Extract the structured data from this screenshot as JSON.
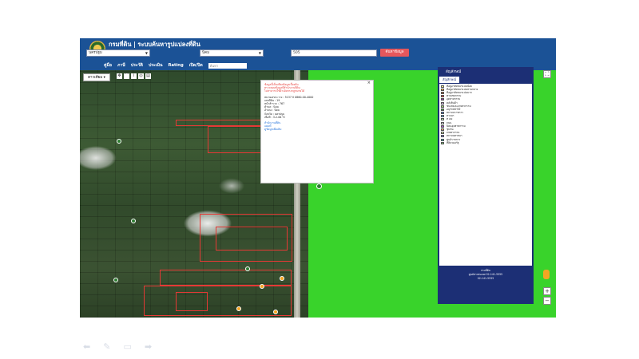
{
  "app": {
    "title": "กรมที่ดิน | ระบบค้นหารูปแปลงที่ดิน"
  },
  "search": {
    "province": "นครปฐม",
    "district": "นิคม",
    "parcel_no": "505",
    "button": "ค้นหาข้อมูล"
  },
  "menu": {
    "items": [
      "คู่มือ",
      "ภาษี",
      "ประวัติ",
      "ประเมิน",
      "Rating",
      "เปิด/ปิด"
    ],
    "search_placeholder": "ค้นหา"
  },
  "map": {
    "basemap_button": "ดาวเทียม",
    "popup": {
      "red_lines": [
        "ข้อมูลนี้เป็นเพียงข้อมูลเบื้องต้น",
        "ตรวจสอบข้อมูลที่สำนักงานที่ดิน",
        "ไม่สามารถใช้อ้างอิงทางกฎหมายได้"
      ],
      "fields": [
        "หมายเลขระวาง : 5137 II 0860-00-4000",
        "เลขที่ดิน : 19",
        "หน้าสำรวจ : 767",
        "ตำบล : นิคม",
        "อำเภอ : นิคม",
        "จังหวัด : นครปฐม",
        "เนื้อที่ : 3-2-64 ไร่"
      ],
      "links": [
        "สำนักงานที่ดิน",
        "แผนที่",
        "ดูข้อมูลเพิ่มเติม"
      ]
    }
  },
  "legend": {
    "title": "สัญลักษณ์",
    "tab": "สัญลักษณ์",
    "items": [
      {
        "label": "ที่อยู่อาศัยหนาแน่นน้อย",
        "color": "#f8f18a"
      },
      {
        "label": "ที่อยู่อาศัยหนาแน่นปานกลาง",
        "color": "#f3a83b"
      },
      {
        "label": "ที่อยู่อาศัยหนาแน่นมาก",
        "color": "#a35b2a"
      },
      {
        "label": "พาณิชยกรรม",
        "color": "#e53935"
      },
      {
        "label": "อุตสาหกรรม",
        "color": "#8e3fa5"
      },
      {
        "label": "คลังสินค้า",
        "color": "#c9a3d8"
      },
      {
        "label": "ชนบทและเกษตรกรรม",
        "color": "#9ad36b"
      },
      {
        "label": "อนุรักษ์ป่าไม้",
        "color": "#3f9a3a"
      },
      {
        "label": "สถาบันราชการ",
        "color": "#3d6fc9"
      },
      {
        "label": "ทางน้ำ",
        "color": "#56a8e0"
      },
      {
        "label": "ที่โล่ง",
        "color": "#b8e2a0"
      },
      {
        "label": "ถนน",
        "color": "#d3d3d3"
      },
      {
        "label": "นิคมอุตสาหกรรม",
        "color": "#a94ad2"
      },
      {
        "label": "ชุมชน",
        "color": "#e8a05c"
      },
      {
        "label": "เกษตรกรรม",
        "color": "#cfe89a"
      },
      {
        "label": "สถาบันศาสนา",
        "color": "#6b6bcc"
      },
      {
        "label": "ศูนย์ราชการ",
        "color": "#2aa7b0"
      },
      {
        "label": "ที่ดินของรัฐ",
        "color": "#7cc26f"
      }
    ],
    "footer": [
      "กรมที่ดิน",
      "ศูนย์สารสนเทศ 02-141-5555",
      "02-141-5555"
    ]
  }
}
